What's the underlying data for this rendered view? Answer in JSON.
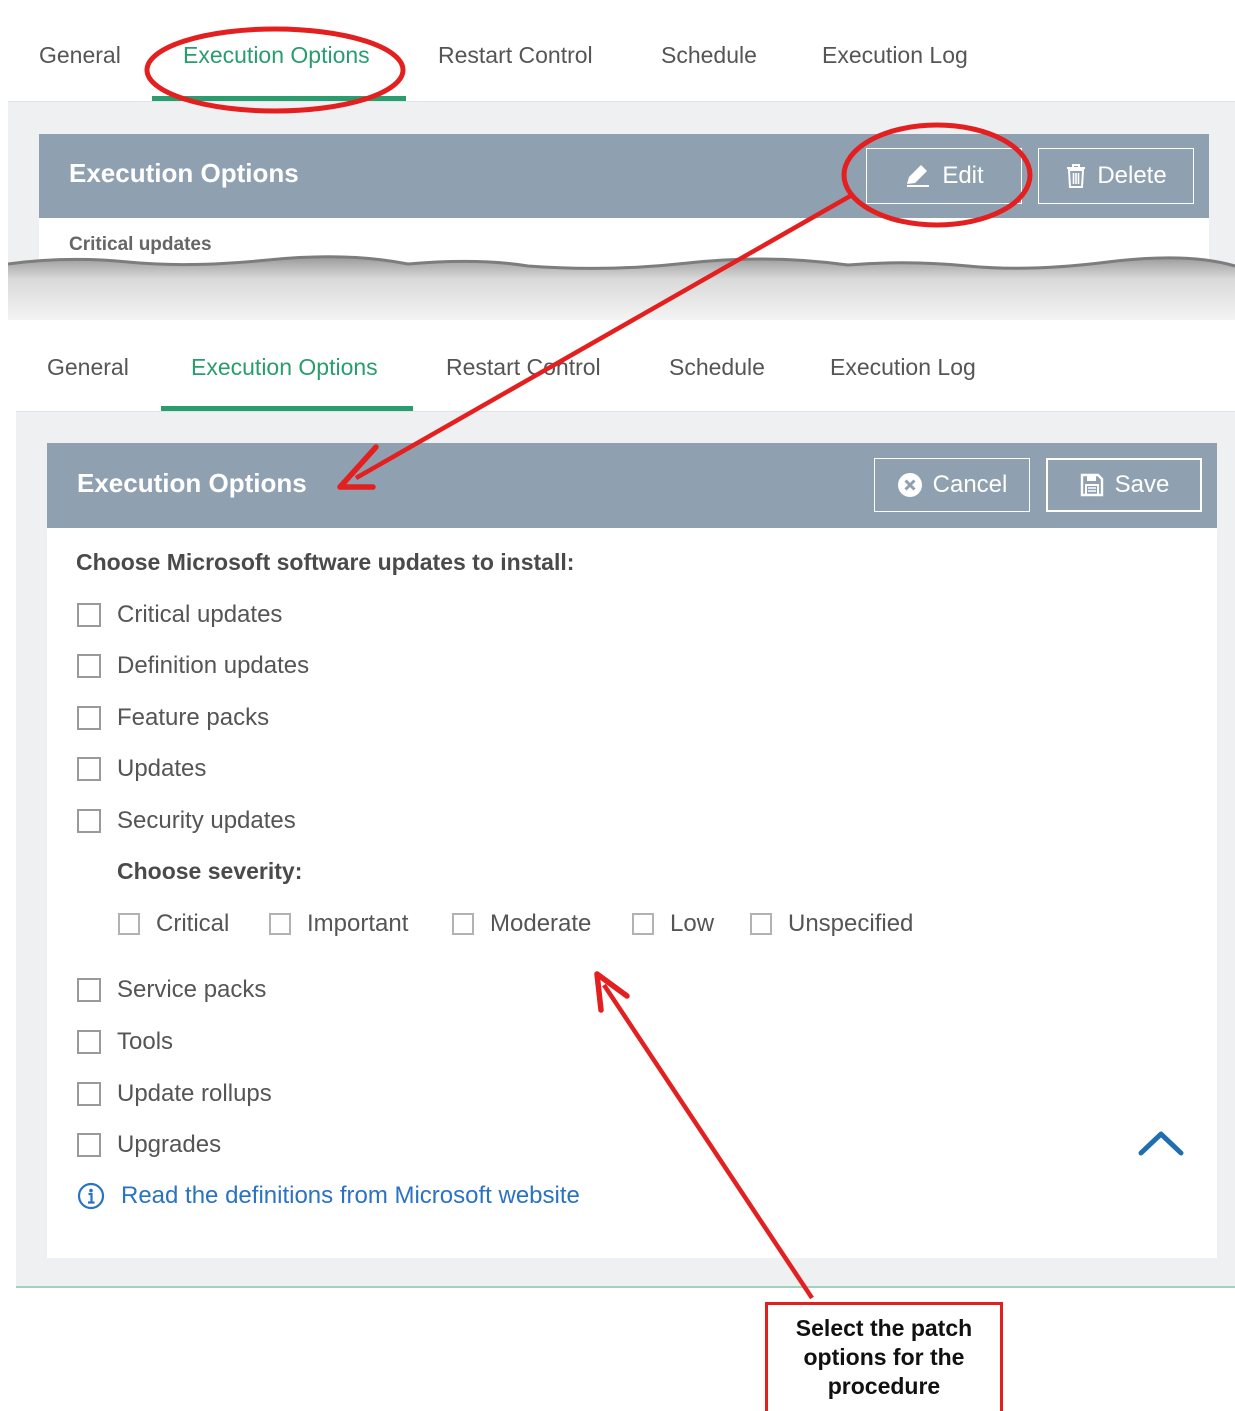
{
  "top": {
    "tabs": [
      "General",
      "Execution Options",
      "Restart Control",
      "Schedule",
      "Execution Log"
    ],
    "active_tab": "Execution Options",
    "panel_title": "Execution Options",
    "edit_label": "Edit",
    "delete_label": "Delete",
    "selected_item": "Critical updates"
  },
  "bottom": {
    "tabs": [
      "General",
      "Execution Options",
      "Restart Control",
      "Schedule",
      "Execution Log"
    ],
    "active_tab": "Execution Options",
    "panel_title": "Execution Options",
    "cancel_label": "Cancel",
    "save_label": "Save",
    "choose_label": "Choose Microsoft software updates to install:",
    "updates": [
      {
        "label": "Critical updates",
        "checked": false
      },
      {
        "label": "Definition updates",
        "checked": false
      },
      {
        "label": "Feature packs",
        "checked": false
      },
      {
        "label": "Updates",
        "checked": false
      },
      {
        "label": "Security updates",
        "checked": false
      }
    ],
    "severity_label": "Choose severity:",
    "severities": [
      {
        "label": "Critical",
        "checked": false
      },
      {
        "label": "Important",
        "checked": false
      },
      {
        "label": "Moderate",
        "checked": false
      },
      {
        "label": "Low",
        "checked": false
      },
      {
        "label": "Unspecified",
        "checked": false
      }
    ],
    "more_updates": [
      {
        "label": "Service packs",
        "checked": false
      },
      {
        "label": "Tools",
        "checked": false
      },
      {
        "label": "Update rollups",
        "checked": false
      },
      {
        "label": "Upgrades",
        "checked": false
      }
    ],
    "info_link": "Read the definitions from Microsoft website"
  },
  "annotation": {
    "callout_lines": [
      "Select the patch",
      "options for the",
      "procedure"
    ],
    "color": "#e41f1f"
  },
  "colors": {
    "accent": "#2a9d6e",
    "panel_header": "#8fa1b0",
    "link": "#2a72c3",
    "scroll_up": "#1f6fb0"
  }
}
